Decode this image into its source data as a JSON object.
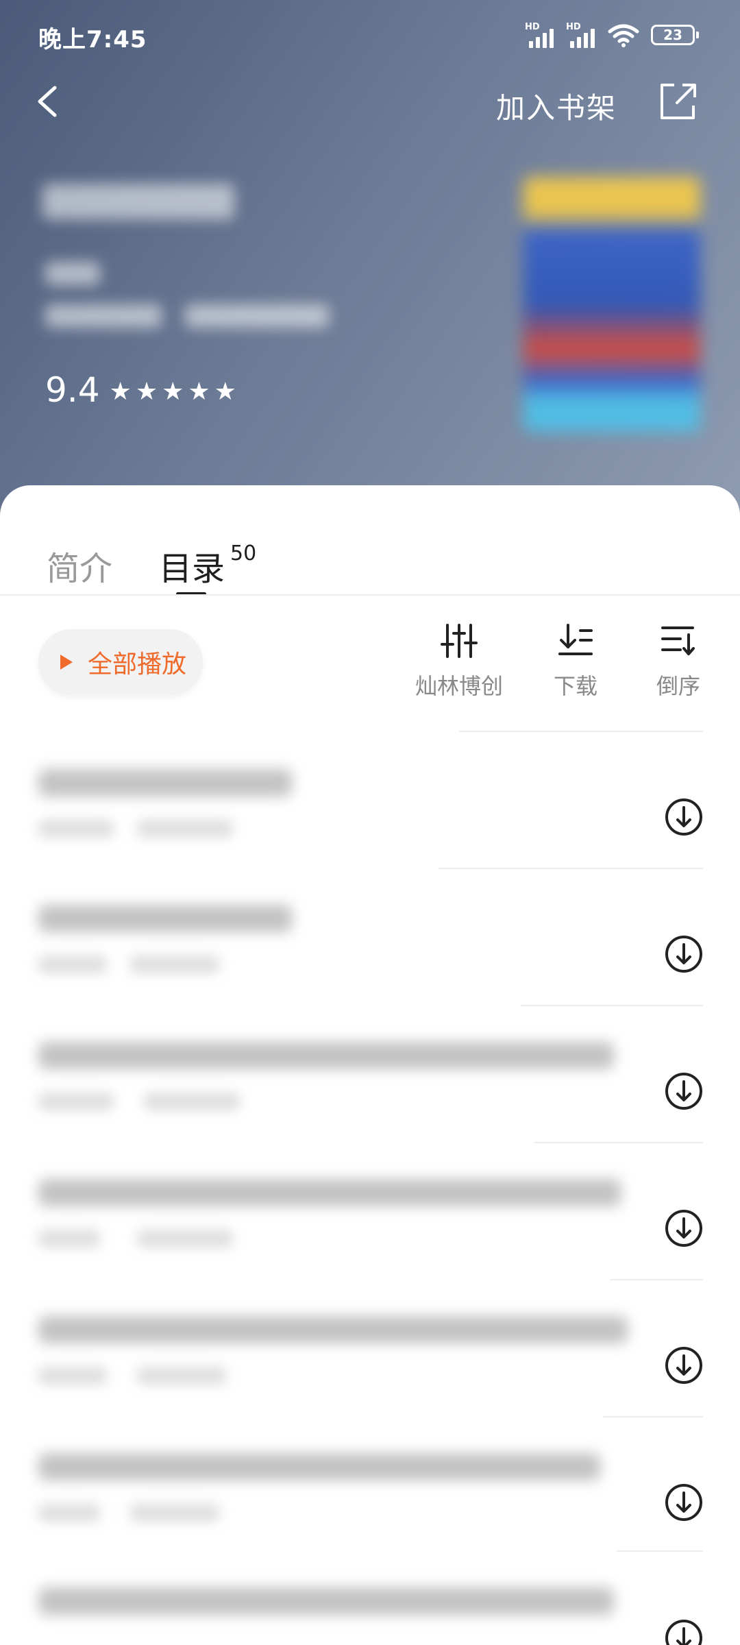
{
  "status_bar": {
    "time": "晚上7:45",
    "battery": "23",
    "hd": "HD"
  },
  "header": {
    "add_to_shelf": "加入书架",
    "rating": "9.4",
    "stars": [
      "★",
      "★",
      "★",
      "★",
      "★"
    ]
  },
  "tabs": {
    "intro": "简介",
    "toc": "目录",
    "toc_count": "50"
  },
  "toolbar": {
    "play_all": "全部播放",
    "filter": "灿林博创",
    "download": "下载",
    "reverse": "倒序"
  },
  "colors": {
    "accent": "#ef6a2b",
    "header_bg": "#5e6d8a"
  },
  "icons": [
    "back-arrow-icon",
    "share-icon",
    "play-icon",
    "equalizer-icon",
    "download-list-icon",
    "sort-reverse-icon",
    "download-circle-icon"
  ]
}
